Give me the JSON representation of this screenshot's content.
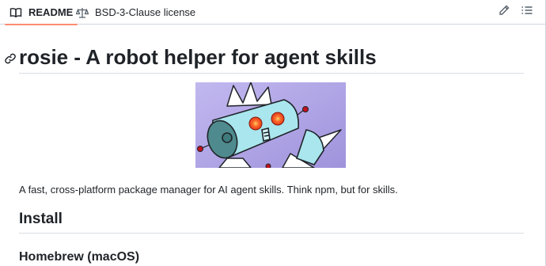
{
  "tabs": [
    {
      "label": "README",
      "icon": "book-icon",
      "active": true
    },
    {
      "label": "BSD-3-Clause license",
      "icon": "scale-icon",
      "active": false
    }
  ],
  "toolbar": {
    "edit_icon": "pencil-icon",
    "toc_icon": "list-icon"
  },
  "readme": {
    "title": "rosie - A robot helper for agent skills",
    "description": "A fast, cross-platform package manager for AI agent skills. Think npm, but for skills.",
    "install_heading": "Install",
    "homebrew_heading": "Homebrew (macOS)"
  },
  "colors": {
    "active_tab_underline": "#fd8c73",
    "image_background": "#b3a7e8",
    "robot_body": "#a9e6ee"
  }
}
